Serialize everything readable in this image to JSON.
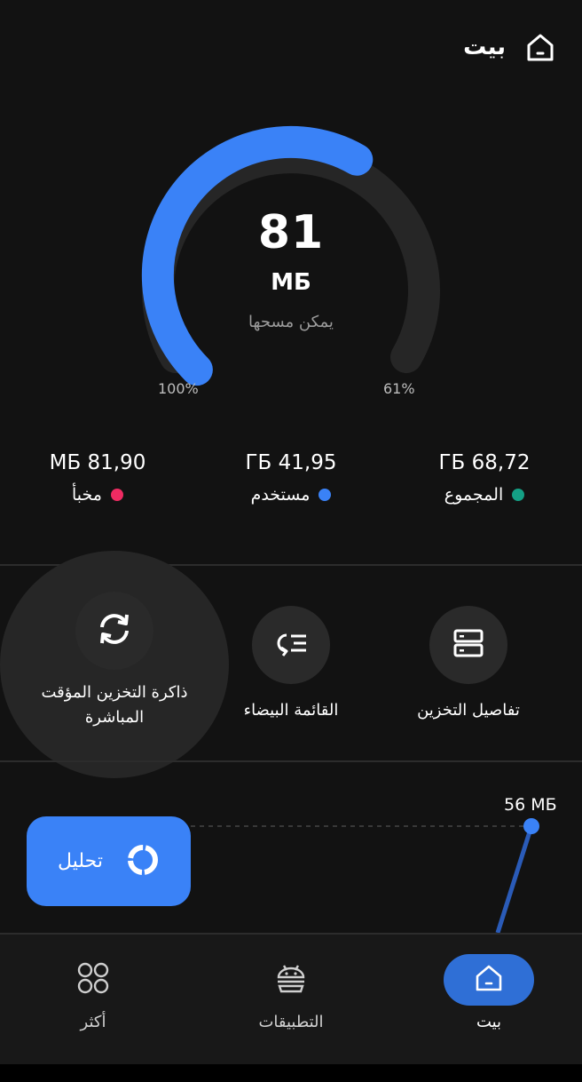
{
  "header": {
    "title": "بيت"
  },
  "gauge": {
    "value": "81",
    "unit": "МБ",
    "caption": "يمكن مسحها",
    "left_label": "100%",
    "right_label": "61%",
    "fill_fraction": 0.61,
    "fill_color": "#3a82f7",
    "track_color": "#262626"
  },
  "stats": [
    {
      "value": "ГБ 68,72",
      "label": "المجموع",
      "color": "#14a085"
    },
    {
      "value": "ГБ 41,95",
      "label": "مستخدم",
      "color": "#3a82f7"
    },
    {
      "value": "МБ 81,90",
      "label": "مخبأ",
      "color": "#ef2b62"
    }
  ],
  "actions": {
    "storage_details": "تفاصيل التخزين",
    "whitelist": "القائمة البيضاء",
    "cache_line1": "ذاكرة التخزين المؤقت",
    "cache_line2": "المباشرة"
  },
  "chart": {
    "peak_label": "56 МБ"
  },
  "analyze": {
    "label": "تحليل"
  },
  "nav": {
    "home": "بيت",
    "apps": "التطبيقات",
    "more": "أكثر"
  }
}
